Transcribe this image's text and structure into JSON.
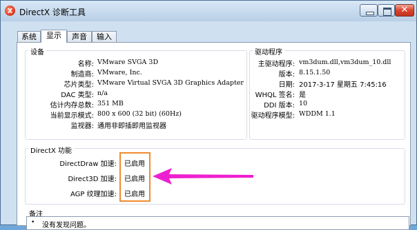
{
  "window": {
    "title": "DirectX 诊断工具"
  },
  "tabs": [
    {
      "label": "系统"
    },
    {
      "label": "显示"
    },
    {
      "label": "声音"
    },
    {
      "label": "输入"
    }
  ],
  "device": {
    "group_title": "设备",
    "rows": [
      {
        "label": "名称:",
        "value": "VMware SVGA 3D"
      },
      {
        "label": "制造商:",
        "value": "VMware, Inc."
      },
      {
        "label": "芯片类型:",
        "value": "VMware Virtual SVGA 3D Graphics Adapter"
      },
      {
        "label": "DAC 类型:",
        "value": "n/a"
      },
      {
        "label": "估计内存总数:",
        "value": "351 MB"
      },
      {
        "label": "当前显示模式:",
        "value": "800 x 600 (32 bit) (60Hz)"
      },
      {
        "label": "监视器:",
        "value": "通用非即插即用监视器"
      }
    ]
  },
  "driver": {
    "group_title": "驱动程序",
    "rows": [
      {
        "label": "主驱动程序:",
        "value": "vm3dum.dll,vm3dum_10.dll"
      },
      {
        "label": "版本:",
        "value": "8.15.1.50"
      },
      {
        "label": "日期:",
        "value": "2017-3-17 星期五 7:45:16"
      },
      {
        "label": "WHQL 签名:",
        "value": "是"
      },
      {
        "label": "DDI 版本:",
        "value": "10"
      },
      {
        "label": "驱动程序模型:",
        "value": "WDDM 1.1"
      }
    ]
  },
  "features": {
    "group_title": "DirectX 功能",
    "rows": [
      {
        "label": "DirectDraw 加速:",
        "value": "已启用"
      },
      {
        "label": "Direct3D 加速:",
        "value": "已启用"
      },
      {
        "label": "AGP 纹理加速:",
        "value": "已启用"
      }
    ]
  },
  "notes": {
    "title": "备注",
    "items": [
      "没有发现问题。"
    ]
  },
  "colors": {
    "highlight_box": "#f08a2e",
    "arrow": "#ee1fd0"
  }
}
